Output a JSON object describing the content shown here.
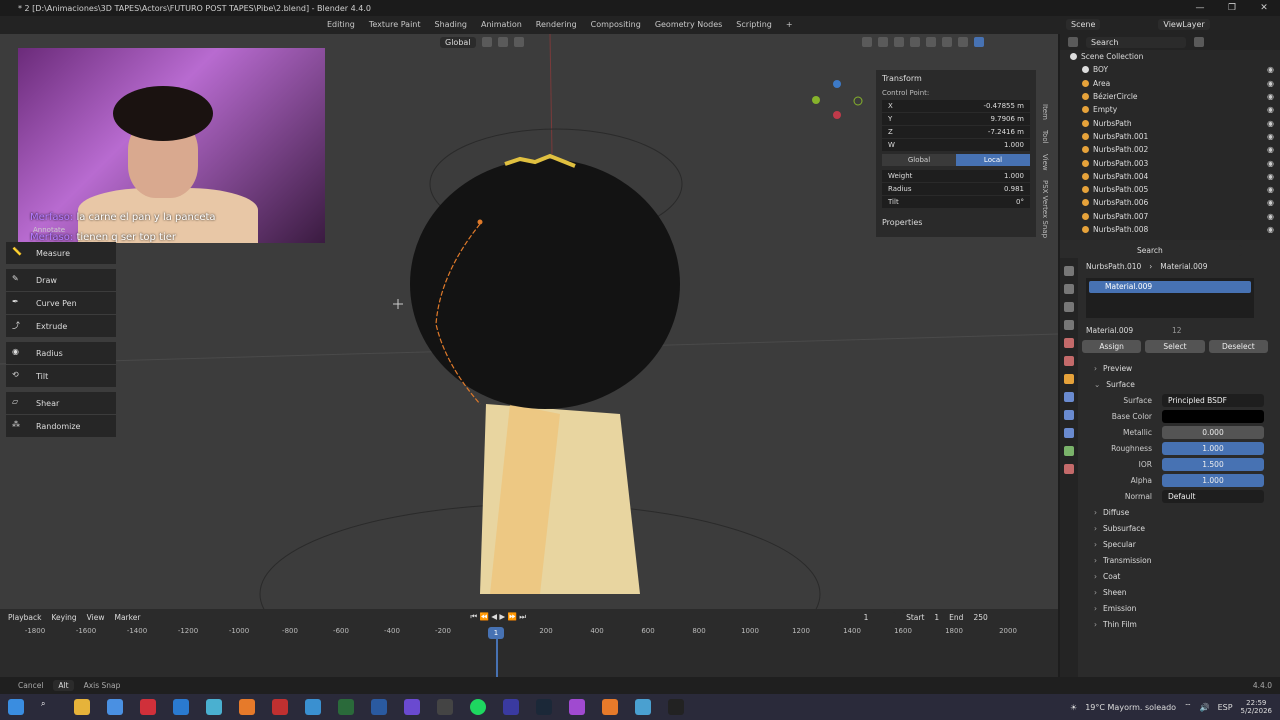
{
  "window": {
    "title": "* 2 [D:\\Animaciones\\3D TAPES\\Actors\\FUTURO POST TAPES\\Pibe\\2.blend] - Blender 4.4.0",
    "controls": [
      "—",
      "❐",
      "✕"
    ]
  },
  "workspaces": [
    "Editing",
    "Texture Paint",
    "Shading",
    "Animation",
    "Rendering",
    "Compositing",
    "Geometry Nodes",
    "Scripting",
    "+"
  ],
  "scene": {
    "name": "Scene",
    "viewlayer": "ViewLayer"
  },
  "viewport": {
    "orientation": "Global"
  },
  "chat": [
    {
      "user": "Merfaso:",
      "text": "la carne el pan y la panceta"
    },
    {
      "user": "Merfaso:",
      "text": "tienen q ser top tier"
    }
  ],
  "tools": {
    "annotate": "Annotate",
    "measure": "Measure",
    "draw": "Draw",
    "curve_pen": "Curve Pen",
    "extrude": "Extrude",
    "radius": "Radius",
    "tilt": "Tilt",
    "shear": "Shear",
    "randomize": "Randomize"
  },
  "transform": {
    "title": "Transform",
    "control_point": "Control Point:",
    "x_label": "X",
    "x": "-0.47855 m",
    "y_label": "Y",
    "y": "9.7906 m",
    "z_label": "Z",
    "z": "-7.2416 m",
    "w_label": "W",
    "w": "1.000",
    "global": "Global",
    "local": "Local",
    "weight_label": "Weight",
    "weight": "1.000",
    "radius_label": "Radius",
    "radius": "0.981",
    "tilt_label": "Tilt",
    "tilt": "0°",
    "properties": "Properties"
  },
  "sidetabs": [
    "Item",
    "Tool",
    "View",
    "PSX Vertex Snap"
  ],
  "outliner": {
    "search": "Search",
    "collection": "Scene Collection",
    "items": [
      "BOY",
      "Area",
      "BézierCircle",
      "Empty",
      "NurbsPath",
      "NurbsPath.001",
      "NurbsPath.002",
      "NurbsPath.003",
      "NurbsPath.004",
      "NurbsPath.005",
      "NurbsPath.006",
      "NurbsPath.007",
      "NurbsPath.008"
    ]
  },
  "props": {
    "search": "Search",
    "object": "NurbsPath.010",
    "material_crumb": "Material.009",
    "slot": "Material.009",
    "material_name": "Material.009",
    "users": "12",
    "assign": "Assign",
    "select": "Select",
    "deselect": "Deselect",
    "preview": "Preview",
    "surface_sec": "Surface",
    "surface_label": "Surface",
    "surface": "Principled BSDF",
    "base_color_label": "Base Color",
    "metallic_label": "Metallic",
    "metallic": "0.000",
    "roughness_label": "Roughness",
    "roughness": "1.000",
    "ior_label": "IOR",
    "ior": "1.500",
    "alpha_label": "Alpha",
    "alpha": "1.000",
    "normal_label": "Normal",
    "normal": "Default",
    "sections": [
      "Diffuse",
      "Subsurface",
      "Specular",
      "Transmission",
      "Coat",
      "Sheen",
      "Emission",
      "Thin Film"
    ]
  },
  "timeline": {
    "menus": [
      "Playback",
      "Keying",
      "View",
      "Marker"
    ],
    "current": "1",
    "start_label": "Start",
    "start": "1",
    "end_label": "End",
    "end": "250",
    "frames": [
      "-1800",
      "-1600",
      "-1400",
      "-1200",
      "-1000",
      "-800",
      "-600",
      "-400",
      "-200",
      "1",
      "200",
      "400",
      "600",
      "800",
      "1000",
      "1200",
      "1400",
      "1600",
      "1800",
      "2000"
    ]
  },
  "status": {
    "cancel": "Cancel",
    "alt": "Alt",
    "axis_snap": "Axis Snap",
    "version": "4.4.0"
  },
  "tray": {
    "weather": "19°C  Mayorm. soleado",
    "lang": "ESP",
    "time": "22:59",
    "date": "5/2/2026"
  },
  "colors": {
    "accent": "#4772b3",
    "curve": "#e07a2a"
  }
}
